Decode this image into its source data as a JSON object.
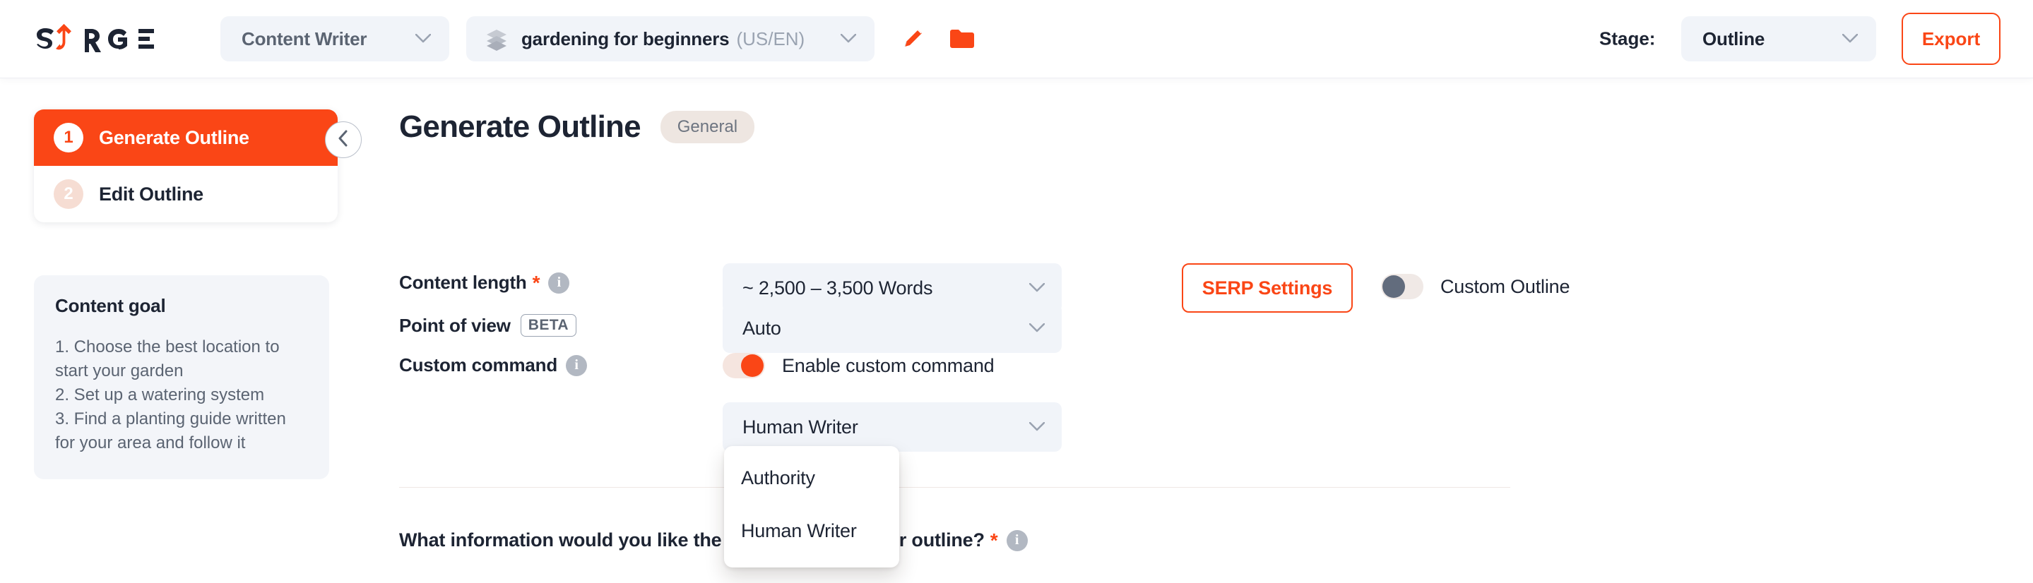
{
  "header": {
    "logo_text": "SURGE",
    "mode_selector": {
      "label": "Content Writer",
      "icon": "chevron-down-icon"
    },
    "document_selector": {
      "icon": "layers-stack-icon",
      "name": "gardening for beginners",
      "locale": "(US/EN)",
      "chevron": "chevron-down-icon"
    },
    "edit_icon": "pencil-icon",
    "folder_icon": "folder-icon",
    "stage_label": "Stage:",
    "stage_value": "Outline",
    "export_label": "Export"
  },
  "sidebar": {
    "steps": [
      {
        "number": "1",
        "label": "Generate Outline",
        "active": true
      },
      {
        "number": "2",
        "label": "Edit Outline",
        "active": false
      }
    ],
    "collapse_icon": "chevron-left-icon",
    "content_goal": {
      "title": "Content goal",
      "body": "1. Choose the best location to start your garden\n2. Set up a watering system\n3. Find a planting guide written for your area and follow it"
    }
  },
  "main": {
    "page_title": "Generate Outline",
    "page_badge": "General",
    "fields": {
      "content_length": {
        "label": "Content length",
        "required": "*",
        "info_icon": "info-icon",
        "value": "~ 2,500 – 3,500 Words"
      },
      "point_of_view": {
        "label": "Point of view",
        "tag": "BETA",
        "value": "Auto"
      },
      "custom_command": {
        "label": "Custom command",
        "info_icon": "info-icon",
        "toggle_label": "Enable custom command",
        "toggle_state": "on",
        "value": "Human Writer"
      }
    },
    "serp_settings_label": "SERP Settings",
    "custom_outline": {
      "label": "Custom Outline",
      "toggle_state": "off"
    },
    "question": "What information would you like the AI to include in your outline?",
    "question_required": "*",
    "question_info_icon": "info-icon",
    "dropdown_menu": {
      "options": [
        "Authority",
        "Human Writer"
      ]
    }
  },
  "colors": {
    "accent": "#fa4616",
    "field_bg": "#f1f4f9",
    "text_dark": "#1d2433",
    "text_muted": "#5b6472"
  }
}
